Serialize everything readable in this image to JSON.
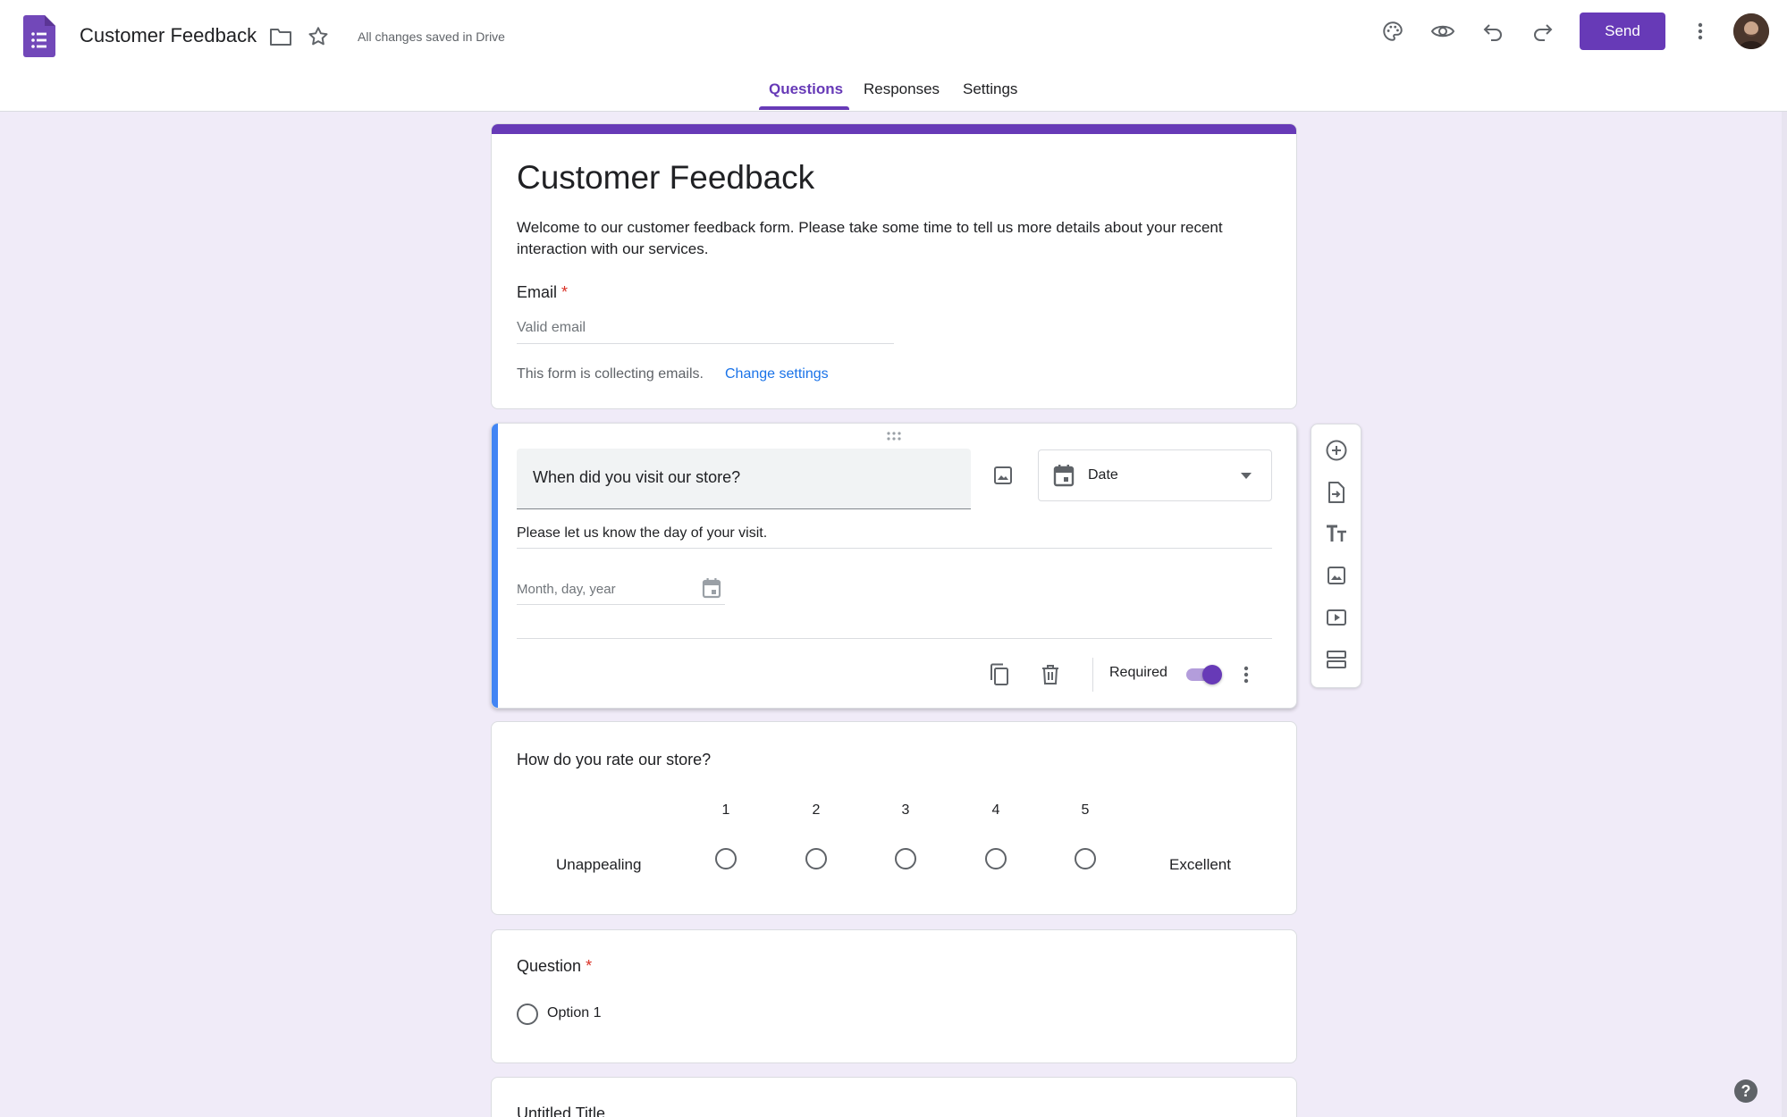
{
  "header": {
    "doc_title": "Customer Feedback",
    "save_status": "All changes saved in Drive",
    "send_label": "Send",
    "icons": [
      "forms-logo-icon",
      "folder-icon",
      "star-icon",
      "palette-icon",
      "preview-eye-icon",
      "undo-icon",
      "redo-icon",
      "more-vert-icon"
    ]
  },
  "tabs": [
    {
      "label": "Questions",
      "active": true
    },
    {
      "label": "Responses",
      "active": false
    },
    {
      "label": "Settings",
      "active": false
    }
  ],
  "form": {
    "title": "Customer Feedback",
    "description": "Welcome to our customer feedback form. Please take some time to tell us more details about your recent interaction with our services.",
    "email_label": "Email",
    "email_placeholder": "Valid email",
    "collecting_note": "This form is collecting emails.",
    "change_settings": "Change settings"
  },
  "active_question": {
    "title": "When did you visit our store?",
    "type": "Date",
    "description": "Please let us know the day of your visit.",
    "date_placeholder": "Month, day, year",
    "required_label": "Required",
    "required": true
  },
  "side_toolbar": [
    "add-question-icon",
    "import-questions-icon",
    "add-title-icon",
    "add-image-icon",
    "add-video-icon",
    "add-section-icon"
  ],
  "rating_question": {
    "title": "How do you rate our store?",
    "scale": [
      "1",
      "2",
      "3",
      "4",
      "5"
    ],
    "low_label": "Unappealing",
    "high_label": "Excellent"
  },
  "choice_question": {
    "title": "Question",
    "options": [
      "Option 1"
    ]
  },
  "next_item": {
    "title": "Untitled Title"
  },
  "colors": {
    "accent": "#673ab7",
    "active_bar": "#4285f4",
    "background": "#f0ebf8",
    "link": "#1a73e8",
    "required": "#d93025"
  }
}
